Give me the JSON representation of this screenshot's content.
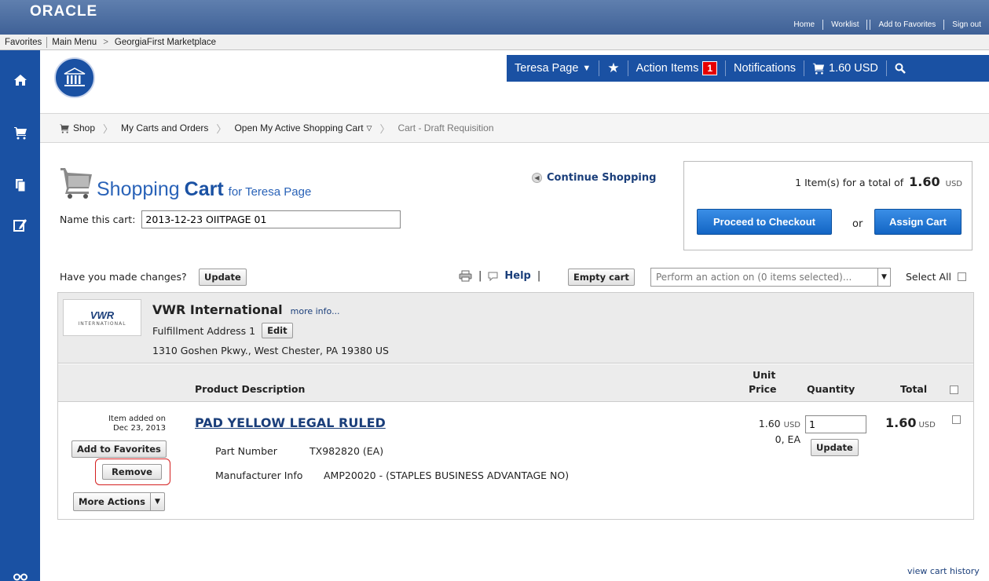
{
  "oracle": {
    "logo": "ORACLE",
    "links": [
      "Home",
      "Worklist",
      "Add to Favorites",
      "Sign out"
    ]
  },
  "nav": {
    "favorites": "Favorites",
    "main_menu": "Main Menu",
    "separator": ">",
    "current": "GeorgiaFirst Marketplace"
  },
  "sidebar": {
    "items": [
      "home-icon",
      "cart-icon",
      "documents-icon",
      "edit-icon",
      "binoculars-icon"
    ]
  },
  "user_bar": {
    "user": "Teresa Page",
    "action_items_label": "Action Items",
    "action_items_count": "1",
    "notifications": "Notifications",
    "cart_total": "1.60 USD"
  },
  "breadcrumb": {
    "items": [
      "Shop",
      "My Carts and Orders",
      "Open My Active Shopping Cart",
      "Cart - Draft Requisition"
    ]
  },
  "cart": {
    "title_part1": "Shopping",
    "title_part2": "Cart",
    "title_for": "for Teresa Page",
    "name_label": "Name this cart:",
    "name_value": "2013-12-23 OIITPAGE 01",
    "continue_shopping": "Continue Shopping"
  },
  "summary": {
    "prefix": "1 Item(s)  for a total of",
    "amount": "1.60",
    "currency": "USD",
    "checkout_label": "Proceed to Checkout",
    "or_label": "or",
    "assign_label": "Assign Cart"
  },
  "actions": {
    "changes_label": "Have you made changes?",
    "update_label": "Update",
    "separator": "|",
    "help_label": "Help",
    "empty_cart_label": "Empty cart",
    "perform_placeholder": "Perform an action on (0 items selected)...",
    "select_all_label": "Select All"
  },
  "supplier": {
    "logo_text": "VWR",
    "logo_sub": "INTERNATIONAL",
    "name": "VWR International",
    "more_info": "more info...",
    "fulfillment": "Fulfillment Address 1",
    "edit_label": "Edit",
    "address": "1310 Goshen Pkwy., West Chester, PA 19380 US"
  },
  "columns": {
    "product_description": "Product Description",
    "unit": "Unit",
    "price": "Price",
    "quantity": "Quantity",
    "total": "Total"
  },
  "item": {
    "added_line1": "Item added on",
    "added_line2": "Dec 23, 2013",
    "add_to_favorites": "Add to Favorites",
    "remove": "Remove",
    "more_actions": "More Actions",
    "title": "PAD YELLOW LEGAL RULED",
    "part_number_label": "Part Number",
    "part_number": "TX982820 (EA)",
    "mfr_label": "Manufacturer Info",
    "mfr_value": "AMP20020 - (STAPLES BUSINESS ADVANTAGE NO)",
    "unit_price": "1.60",
    "unit_currency": "USD",
    "unit_of_measure": "0, EA",
    "quantity": "1",
    "update_label": "Update",
    "total": "1.60",
    "total_currency": "USD"
  },
  "footer": {
    "history_link": "view cart history"
  },
  "colors": {
    "brand_blue": "#1a51a3",
    "oracle_bar": "#4a6da2",
    "button_blue": "#1365c4",
    "badge_red": "#e60000",
    "highlight_red": "#d42020"
  }
}
